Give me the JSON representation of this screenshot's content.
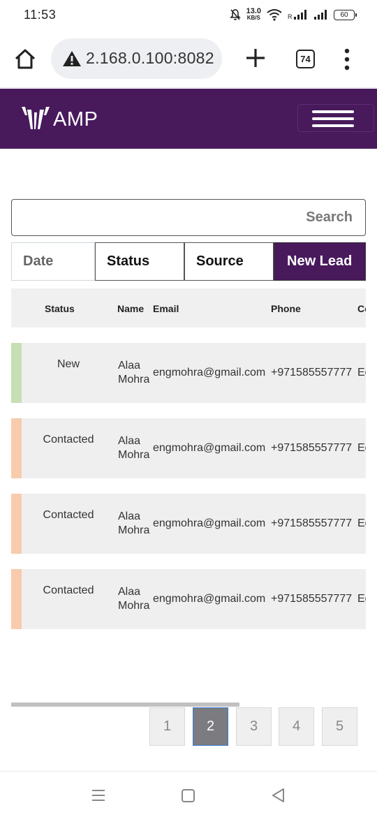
{
  "status_bar": {
    "time": "11:53",
    "net_speed_value": "13.0",
    "net_speed_unit": "KB/S",
    "battery": "60"
  },
  "browser": {
    "url": "2.168.0.100:8082",
    "tab_count": "74"
  },
  "app": {
    "logo_text": "AMP",
    "brand_color": "#481a5c"
  },
  "search": {
    "placeholder": "Search",
    "value": ""
  },
  "filters": {
    "date": "Date",
    "status": "Status",
    "source": "Source",
    "new_lead": "New Lead"
  },
  "table": {
    "columns": {
      "status": "Status",
      "name": "Name",
      "email": "Email",
      "phone": "Phone",
      "country": "Co"
    },
    "rows": [
      {
        "status": "New",
        "name_first": "Alaa",
        "name_last": "Mohra",
        "email": "engmohra@gmail.com",
        "phone": "+971585557777",
        "country": "Eg",
        "status_color": "#c6e0b4"
      },
      {
        "status": "Contacted",
        "name_first": "Alaa",
        "name_last": "Mohra",
        "email": "engmohra@gmail.com",
        "phone": "+971585557777",
        "country": "Eg",
        "status_color": "#f8cbad"
      },
      {
        "status": "Contacted",
        "name_first": "Alaa",
        "name_last": "Mohra",
        "email": "engmohra@gmail.com",
        "phone": "+971585557777",
        "country": "Eg",
        "status_color": "#f8cbad"
      },
      {
        "status": "Contacted",
        "name_first": "Alaa",
        "name_last": "Mohra",
        "email": "engmohra@gmail.com",
        "phone": "+971585557777",
        "country": "Eg",
        "status_color": "#f8cbad"
      }
    ]
  },
  "pagination": {
    "pages": [
      "1",
      "2",
      "3",
      "4",
      "5"
    ],
    "current": "2"
  }
}
